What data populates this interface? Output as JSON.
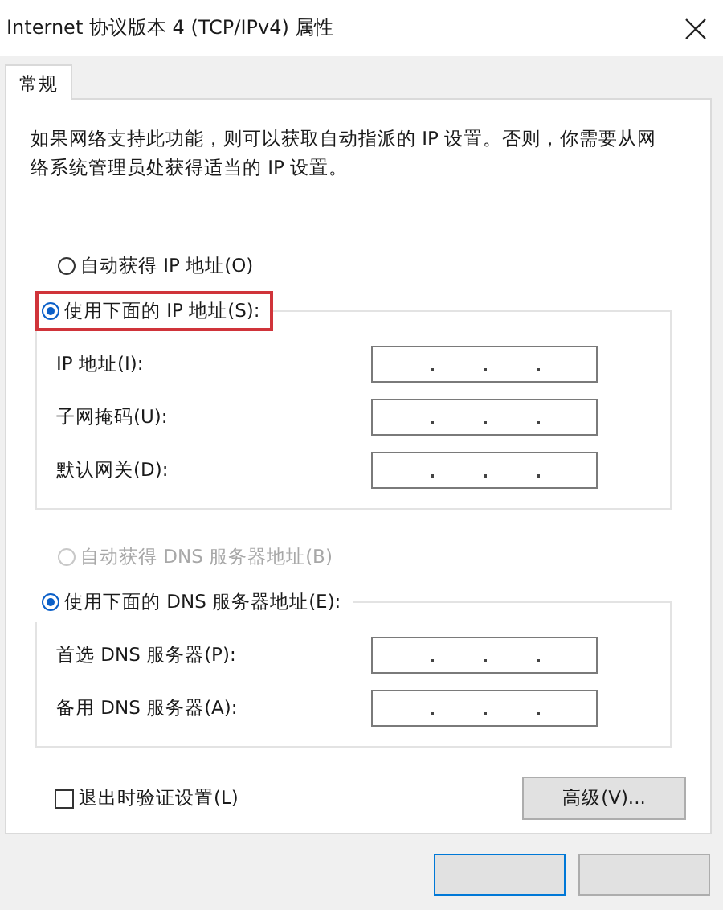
{
  "window": {
    "title": "Internet 协议版本 4 (TCP/IPv4) 属性"
  },
  "tabs": [
    {
      "label": "常规",
      "selected": true
    }
  ],
  "description": "如果网络支持此功能，则可以获取自动指派的 IP 设置。否则，你需要从网络系统管理员处获得适当的 IP 设置。",
  "ip_options": [
    {
      "label": "自动获得 IP 地址(O)",
      "selected": false,
      "disabled": false,
      "highlighted": false
    },
    {
      "label": "使用下面的 IP 地址(S):",
      "selected": true,
      "disabled": false,
      "highlighted": true
    }
  ],
  "ip_fields": [
    {
      "label": "IP 地址(I):"
    },
    {
      "label": "子网掩码(U):"
    },
    {
      "label": "默认网关(D):"
    }
  ],
  "dns_options": [
    {
      "label": "自动获得 DNS 服务器地址(B)",
      "selected": false,
      "disabled": true,
      "highlighted": false
    },
    {
      "label": "使用下面的 DNS 服务器地址(E):",
      "selected": true,
      "disabled": false,
      "highlighted": false
    }
  ],
  "dns_fields": [
    {
      "label": "首选 DNS 服务器(P):"
    },
    {
      "label": "备用 DNS 服务器(A):"
    }
  ],
  "validate_checkbox": {
    "label": "退出时验证设置(L)",
    "checked": false
  },
  "advanced_button": "高级(V)..."
}
